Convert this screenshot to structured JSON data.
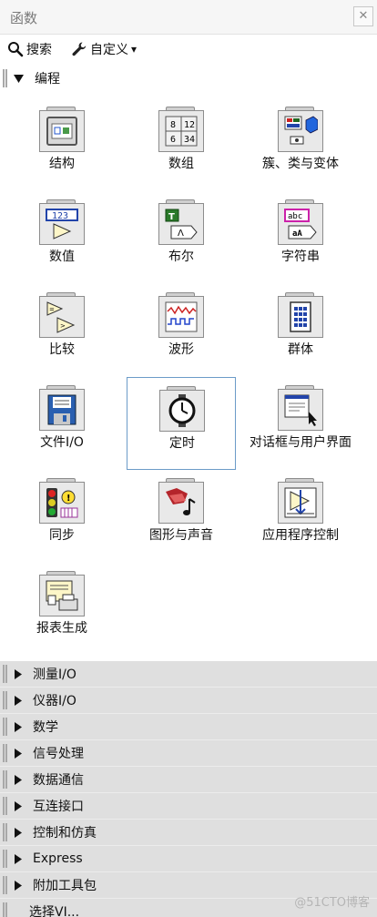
{
  "window": {
    "title": "函数",
    "close_glyph": "✕",
    "close_icon": "close-icon"
  },
  "toolbar": {
    "search_label": "搜索",
    "search_icon": "search-icon",
    "customize_label": "自定义",
    "customize_icon": "wrench-icon",
    "customize_arrow": "▾"
  },
  "open_category": {
    "label": "编程",
    "arrow": "▼"
  },
  "tiles": [
    {
      "label": "结构",
      "icon": "structure-icon"
    },
    {
      "label": "数组",
      "icon": "array-icon"
    },
    {
      "label": "簇、类与变体",
      "icon": "cluster-class-variant-icon"
    },
    {
      "label": "数值",
      "icon": "numeric-icon"
    },
    {
      "label": "布尔",
      "icon": "boolean-icon"
    },
    {
      "label": "字符串",
      "icon": "string-icon"
    },
    {
      "label": "比较",
      "icon": "comparison-icon"
    },
    {
      "label": "波形",
      "icon": "waveform-icon"
    },
    {
      "label": "群体",
      "icon": "cluster-group-icon"
    },
    {
      "label": "文件I/O",
      "icon": "file-io-icon"
    },
    {
      "label": "定时",
      "icon": "timing-watch-icon"
    },
    {
      "label": "对话框与用户界面",
      "icon": "dialog-ui-icon"
    },
    {
      "label": "同步",
      "icon": "synchronization-icon"
    },
    {
      "label": "图形与声音",
      "icon": "graphics-sound-icon"
    },
    {
      "label": "应用程序控制",
      "icon": "application-control-icon"
    },
    {
      "label": "报表生成",
      "icon": "report-generation-icon"
    }
  ],
  "selected_tile": "定时",
  "collapsed_categories": [
    {
      "label": "测量I/O"
    },
    {
      "label": "仪器I/O"
    },
    {
      "label": "数学"
    },
    {
      "label": "信号处理"
    },
    {
      "label": "数据通信"
    },
    {
      "label": "互连接口"
    },
    {
      "label": "控制和仿真"
    },
    {
      "label": "Express"
    },
    {
      "label": "附加工具包"
    },
    {
      "label": "选择VI..."
    }
  ],
  "watermark": "@51CTO博客",
  "colors": {
    "selection_border": "#6c9bc8",
    "collapsed_bg": "#dfdfdf"
  }
}
